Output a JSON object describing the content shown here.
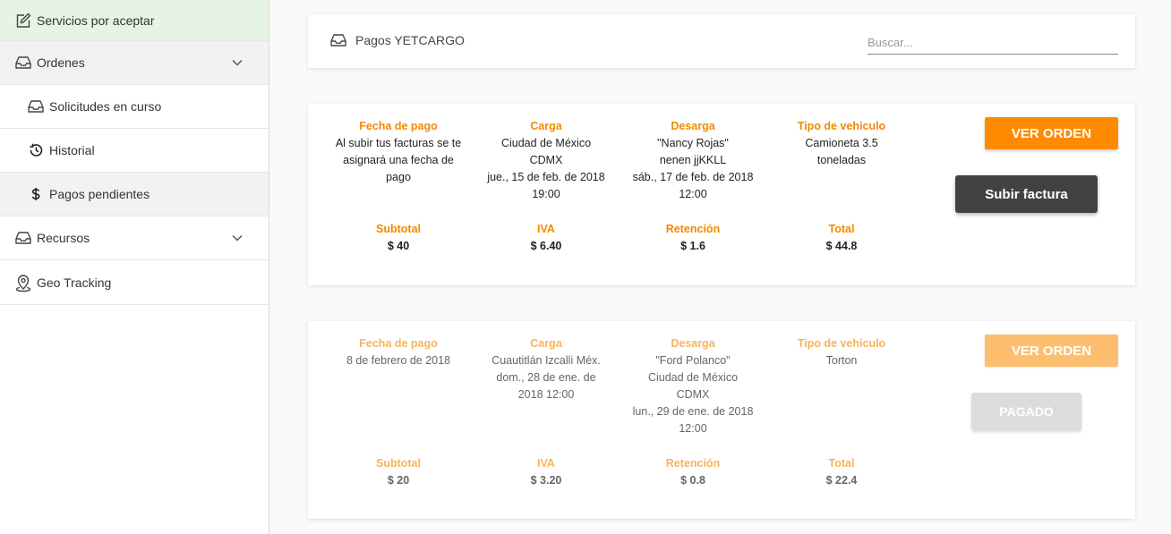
{
  "sidebar": {
    "services": {
      "label": "Servicios por aceptar",
      "icon": "edit-icon"
    },
    "ordenes": {
      "label": "Ordenes",
      "icon": "inbox-icon"
    },
    "solicitudes": {
      "label": "Solicitudes en curso",
      "icon": "inbox-icon"
    },
    "historial": {
      "label": "Historial",
      "icon": "history-icon"
    },
    "pagos": {
      "label": "Pagos pendientes",
      "icon": "dollar-icon"
    },
    "recursos": {
      "label": "Recursos",
      "icon": "inbox-icon"
    },
    "geo": {
      "label": "Geo Tracking",
      "icon": "location-pin-icon"
    }
  },
  "header": {
    "title": "Pagos YETCARGO",
    "search_placeholder": "Buscar..."
  },
  "labels": {
    "fecha_pago": "Fecha de pago",
    "carga": "Carga",
    "desarga": "Desarga",
    "tipo_vehiculo": "Tipo de vehiculo",
    "subtotal": "Subtotal",
    "iva": "IVA",
    "retencion": "Retención",
    "total": "Total"
  },
  "orders": [
    {
      "fecha_pago": "Al subir tus facturas se te asignará una fecha de pago",
      "carga": "Ciudad de México\nCDMX\njue., 15 de feb. de 2018\n19:00",
      "desarga": "\"Nancy Rojas\"\nnenen jjKKLL\nsáb., 17 de feb. de 2018\n12:00",
      "tipo_vehiculo": "Camioneta 3.5\ntoneladas",
      "subtotal": "$ 40",
      "iva": "$ 6.40",
      "retencion": "$ 1.6",
      "total": "$ 44.8",
      "ver_orden": "VER ORDEN",
      "action": "Subir factura"
    },
    {
      "fecha_pago": "8 de febrero de 2018",
      "carga": "Cuautitlán Izcalli Méx.\ndom., 28 de ene. de\n2018 12:00",
      "desarga": "\"Ford Polanco\"\nCiudad de México\nCDMX\nlun., 29 de ene. de 2018\n12:00",
      "tipo_vehiculo": "Torton",
      "subtotal": "$ 20",
      "iva": "$ 3.20",
      "retencion": "$ 0.8",
      "total": "$ 22.4",
      "ver_orden": "VER ORDEN",
      "action": "PAGADO"
    }
  ],
  "colors": {
    "accent": "#ff8a00",
    "accent_dim": "#fdbf6f",
    "label_orange": "#f28a00",
    "dark_button": "#424242",
    "disabled_button": "#dcdcdc",
    "active_green": "#e6f4e6"
  }
}
